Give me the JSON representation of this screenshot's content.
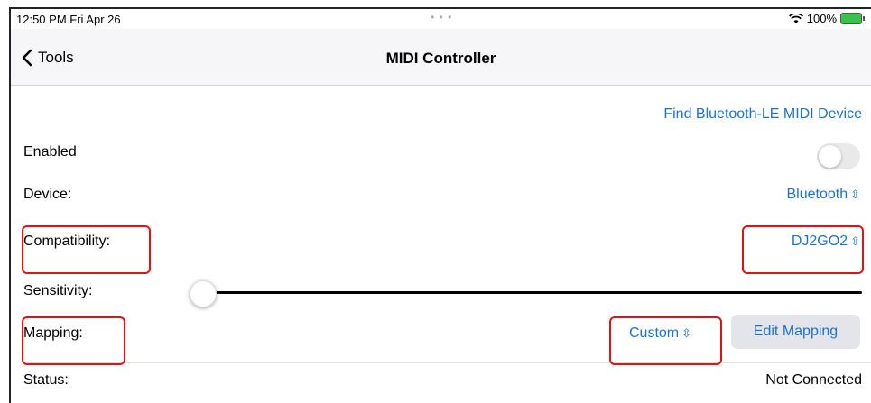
{
  "status_bar": {
    "time": "12:50 PM  Fri Apr 26",
    "dots": "• • •",
    "wifi_icon": "wifi-icon",
    "battery": "100%",
    "battery_icon": "battery-charging-icon"
  },
  "nav": {
    "back_label": "Tools",
    "back_icon": "chevron-left-icon",
    "title": "MIDI Controller"
  },
  "content": {
    "find_device_link": "Find Bluetooth-LE MIDI Device",
    "enabled": {
      "label": "Enabled",
      "on": false
    },
    "device": {
      "label": "Device:",
      "value": "Bluetooth"
    },
    "compatibility": {
      "label": "Compatibility:",
      "value": "DJ2GO2"
    },
    "sensitivity": {
      "label": "Sensitivity:",
      "level": 0.0
    },
    "mapping": {
      "label": "Mapping:",
      "value": "Custom",
      "edit_button": "Edit Mapping"
    },
    "status": {
      "label": "Status:",
      "value": "Not Connected"
    },
    "picker_icon": "chevron-up-down-icon"
  },
  "colors": {
    "accent": "#1b72d0",
    "highlight": "#e01414"
  }
}
